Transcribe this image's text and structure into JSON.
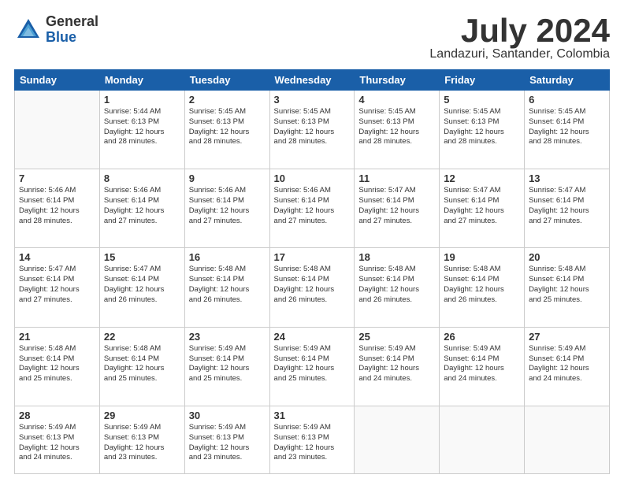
{
  "logo": {
    "general": "General",
    "blue": "Blue"
  },
  "title": "July 2024",
  "location": "Landazuri, Santander, Colombia",
  "weekdays": [
    "Sunday",
    "Monday",
    "Tuesday",
    "Wednesday",
    "Thursday",
    "Friday",
    "Saturday"
  ],
  "weeks": [
    [
      {
        "day": "",
        "sunrise": "",
        "sunset": "",
        "daylight": ""
      },
      {
        "day": "1",
        "sunrise": "Sunrise: 5:44 AM",
        "sunset": "Sunset: 6:13 PM",
        "daylight": "Daylight: 12 hours and 28 minutes."
      },
      {
        "day": "2",
        "sunrise": "Sunrise: 5:45 AM",
        "sunset": "Sunset: 6:13 PM",
        "daylight": "Daylight: 12 hours and 28 minutes."
      },
      {
        "day": "3",
        "sunrise": "Sunrise: 5:45 AM",
        "sunset": "Sunset: 6:13 PM",
        "daylight": "Daylight: 12 hours and 28 minutes."
      },
      {
        "day": "4",
        "sunrise": "Sunrise: 5:45 AM",
        "sunset": "Sunset: 6:13 PM",
        "daylight": "Daylight: 12 hours and 28 minutes."
      },
      {
        "day": "5",
        "sunrise": "Sunrise: 5:45 AM",
        "sunset": "Sunset: 6:13 PM",
        "daylight": "Daylight: 12 hours and 28 minutes."
      },
      {
        "day": "6",
        "sunrise": "Sunrise: 5:45 AM",
        "sunset": "Sunset: 6:14 PM",
        "daylight": "Daylight: 12 hours and 28 minutes."
      }
    ],
    [
      {
        "day": "7",
        "sunrise": "Sunrise: 5:46 AM",
        "sunset": "Sunset: 6:14 PM",
        "daylight": "Daylight: 12 hours and 28 minutes."
      },
      {
        "day": "8",
        "sunrise": "Sunrise: 5:46 AM",
        "sunset": "Sunset: 6:14 PM",
        "daylight": "Daylight: 12 hours and 27 minutes."
      },
      {
        "day": "9",
        "sunrise": "Sunrise: 5:46 AM",
        "sunset": "Sunset: 6:14 PM",
        "daylight": "Daylight: 12 hours and 27 minutes."
      },
      {
        "day": "10",
        "sunrise": "Sunrise: 5:46 AM",
        "sunset": "Sunset: 6:14 PM",
        "daylight": "Daylight: 12 hours and 27 minutes."
      },
      {
        "day": "11",
        "sunrise": "Sunrise: 5:47 AM",
        "sunset": "Sunset: 6:14 PM",
        "daylight": "Daylight: 12 hours and 27 minutes."
      },
      {
        "day": "12",
        "sunrise": "Sunrise: 5:47 AM",
        "sunset": "Sunset: 6:14 PM",
        "daylight": "Daylight: 12 hours and 27 minutes."
      },
      {
        "day": "13",
        "sunrise": "Sunrise: 5:47 AM",
        "sunset": "Sunset: 6:14 PM",
        "daylight": "Daylight: 12 hours and 27 minutes."
      }
    ],
    [
      {
        "day": "14",
        "sunrise": "Sunrise: 5:47 AM",
        "sunset": "Sunset: 6:14 PM",
        "daylight": "Daylight: 12 hours and 27 minutes."
      },
      {
        "day": "15",
        "sunrise": "Sunrise: 5:47 AM",
        "sunset": "Sunset: 6:14 PM",
        "daylight": "Daylight: 12 hours and 26 minutes."
      },
      {
        "day": "16",
        "sunrise": "Sunrise: 5:48 AM",
        "sunset": "Sunset: 6:14 PM",
        "daylight": "Daylight: 12 hours and 26 minutes."
      },
      {
        "day": "17",
        "sunrise": "Sunrise: 5:48 AM",
        "sunset": "Sunset: 6:14 PM",
        "daylight": "Daylight: 12 hours and 26 minutes."
      },
      {
        "day": "18",
        "sunrise": "Sunrise: 5:48 AM",
        "sunset": "Sunset: 6:14 PM",
        "daylight": "Daylight: 12 hours and 26 minutes."
      },
      {
        "day": "19",
        "sunrise": "Sunrise: 5:48 AM",
        "sunset": "Sunset: 6:14 PM",
        "daylight": "Daylight: 12 hours and 26 minutes."
      },
      {
        "day": "20",
        "sunrise": "Sunrise: 5:48 AM",
        "sunset": "Sunset: 6:14 PM",
        "daylight": "Daylight: 12 hours and 25 minutes."
      }
    ],
    [
      {
        "day": "21",
        "sunrise": "Sunrise: 5:48 AM",
        "sunset": "Sunset: 6:14 PM",
        "daylight": "Daylight: 12 hours and 25 minutes."
      },
      {
        "day": "22",
        "sunrise": "Sunrise: 5:48 AM",
        "sunset": "Sunset: 6:14 PM",
        "daylight": "Daylight: 12 hours and 25 minutes."
      },
      {
        "day": "23",
        "sunrise": "Sunrise: 5:49 AM",
        "sunset": "Sunset: 6:14 PM",
        "daylight": "Daylight: 12 hours and 25 minutes."
      },
      {
        "day": "24",
        "sunrise": "Sunrise: 5:49 AM",
        "sunset": "Sunset: 6:14 PM",
        "daylight": "Daylight: 12 hours and 25 minutes."
      },
      {
        "day": "25",
        "sunrise": "Sunrise: 5:49 AM",
        "sunset": "Sunset: 6:14 PM",
        "daylight": "Daylight: 12 hours and 24 minutes."
      },
      {
        "day": "26",
        "sunrise": "Sunrise: 5:49 AM",
        "sunset": "Sunset: 6:14 PM",
        "daylight": "Daylight: 12 hours and 24 minutes."
      },
      {
        "day": "27",
        "sunrise": "Sunrise: 5:49 AM",
        "sunset": "Sunset: 6:14 PM",
        "daylight": "Daylight: 12 hours and 24 minutes."
      }
    ],
    [
      {
        "day": "28",
        "sunrise": "Sunrise: 5:49 AM",
        "sunset": "Sunset: 6:13 PM",
        "daylight": "Daylight: 12 hours and 24 minutes."
      },
      {
        "day": "29",
        "sunrise": "Sunrise: 5:49 AM",
        "sunset": "Sunset: 6:13 PM",
        "daylight": "Daylight: 12 hours and 23 minutes."
      },
      {
        "day": "30",
        "sunrise": "Sunrise: 5:49 AM",
        "sunset": "Sunset: 6:13 PM",
        "daylight": "Daylight: 12 hours and 23 minutes."
      },
      {
        "day": "31",
        "sunrise": "Sunrise: 5:49 AM",
        "sunset": "Sunset: 6:13 PM",
        "daylight": "Daylight: 12 hours and 23 minutes."
      },
      {
        "day": "",
        "sunrise": "",
        "sunset": "",
        "daylight": ""
      },
      {
        "day": "",
        "sunrise": "",
        "sunset": "",
        "daylight": ""
      },
      {
        "day": "",
        "sunrise": "",
        "sunset": "",
        "daylight": ""
      }
    ]
  ]
}
